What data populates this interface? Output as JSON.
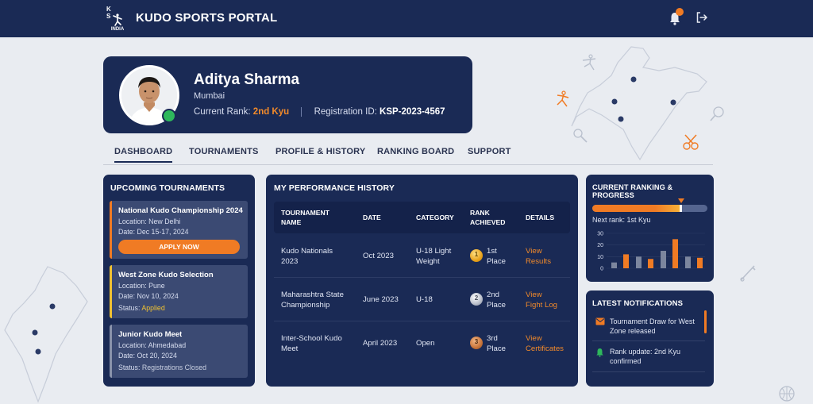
{
  "app": {
    "title": "KUDO SPORTS PORTAL",
    "logo_letters": "K S",
    "logo_country": "INDIA"
  },
  "colors": {
    "navy": "#1a2a55",
    "accent": "#f07b24",
    "success": "#2eb85c",
    "warning": "#f1c232",
    "gold": "#e8a21c",
    "silver": "#b8bdc9",
    "bronze": "#c8743a"
  },
  "header_icons": [
    "bell-icon",
    "logout-icon"
  ],
  "profile": {
    "name": "Aditya Sharma",
    "city": "Mumbai",
    "rank_label": "Current Rank:",
    "rank_value": "2nd Kyu",
    "reg_label": "Registration ID:",
    "reg_value": "KSP-2023-4567",
    "online": true
  },
  "nav": {
    "tabs": [
      "DASHBOARD",
      "TOURNAMENTS",
      "PROFILE & HISTORY",
      "RANKING BOARD",
      "SUPPORT"
    ],
    "active": "DASHBOARD"
  },
  "upcoming": {
    "title": "UPCOMING TOURNAMENTS",
    "cards": [
      {
        "name": "National Kudo Championship 2024",
        "location": "Location: New Delhi",
        "date": "Date: Dec 15-17, 2024",
        "action": "APPLY NOW",
        "accent": "#f07b24"
      },
      {
        "name": "West Zone Kudo Selection",
        "location": "Location: Pune",
        "date": "Date: Nov 10, 2024",
        "status_label": "Status:",
        "status_value": "Applied",
        "accent": "#f1c232"
      },
      {
        "name": "Junior Kudo Meet",
        "location": "Location: Ahmedabad",
        "date": "Date: Oct 20, 2024",
        "status_label": "Status:",
        "status_value": "Registrations Closed",
        "accent": "#8a93ab"
      }
    ]
  },
  "history": {
    "title": "MY PERFORMANCE HISTORY",
    "headers": {
      "name_1": "TOURNAMENT",
      "name_2": "NAME",
      "date": "DATE",
      "category": "CATEGORY",
      "rank_1": "RANK",
      "rank_2": "ACHIEVED",
      "details": "DETAILS"
    },
    "rows": [
      {
        "name_1": "Kudo Nationals",
        "name_2": "2023",
        "date": "Oct 2023",
        "category_1": "U-18 Light",
        "category_2": "Weight",
        "medal_num": "1",
        "rank_1": "1st",
        "rank_2": "Place",
        "link_1": "View",
        "link_2": "Results"
      },
      {
        "name_1": "Maharashtra State",
        "name_2": "Championship",
        "date": "June 2023",
        "category_1": "U-18",
        "category_2": "",
        "medal_num": "2",
        "rank_1": "2nd",
        "rank_2": "Place",
        "link_1": "View",
        "link_2": "Fight Log"
      },
      {
        "name_1": "Inter-School Kudo",
        "name_2": "Meet",
        "date": "April 2023",
        "category_1": "Open",
        "category_2": "",
        "medal_num": "3",
        "rank_1": "3rd",
        "rank_2": "Place",
        "link_1": "View",
        "link_2": "Certificates"
      }
    ]
  },
  "ranking": {
    "title": "CURRENT RANKING & PROGRESS",
    "progress": 0.78,
    "next_rank": "Next rank: 1st Kyu",
    "chart_data": {
      "type": "bar",
      "ylim": [
        0,
        30
      ],
      "yticks": [
        "0",
        "10",
        "20",
        "30"
      ],
      "series": [
        {
          "values": [
            5,
            10,
            15,
            10
          ]
        },
        {
          "values": [
            12,
            8,
            25,
            9
          ]
        }
      ],
      "colors": [
        "#7c869e",
        "#f07b24"
      ]
    }
  },
  "notifications": {
    "title": "LATEST NOTIFICATIONS",
    "items": [
      {
        "icon": "mail-icon",
        "text": "Tournament Draw for West Zone released"
      },
      {
        "icon": "bell-icon",
        "text": "Rank update: 2nd Kyu confirmed"
      }
    ]
  }
}
